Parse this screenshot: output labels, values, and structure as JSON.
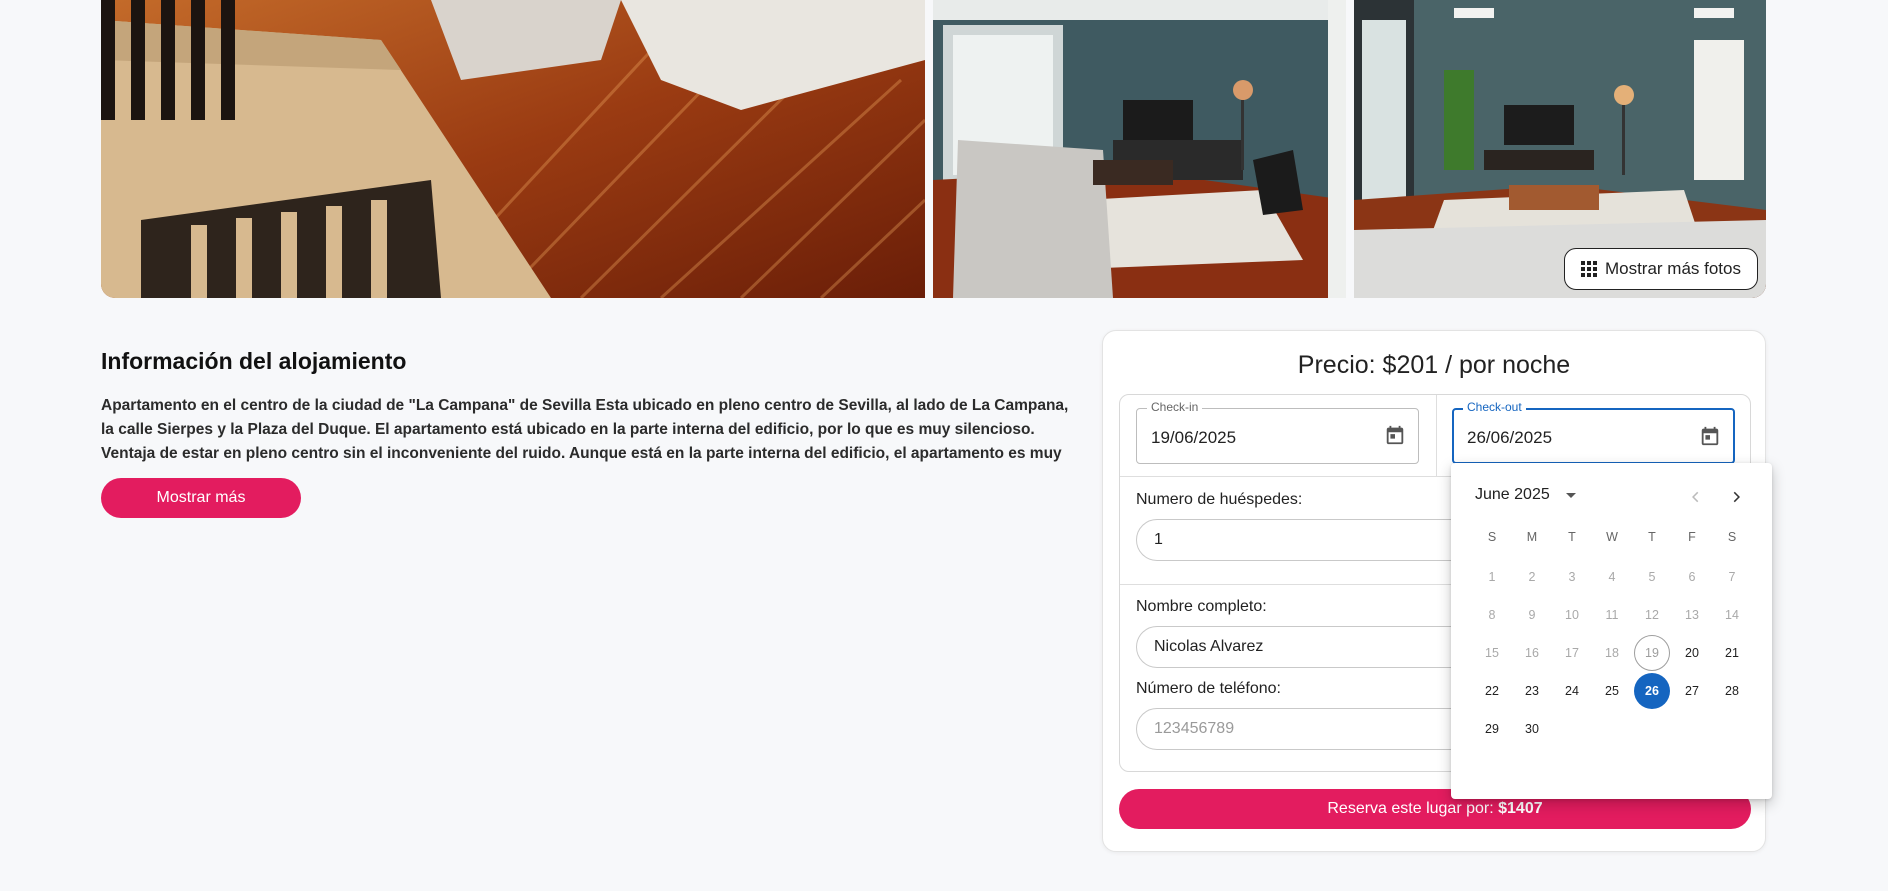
{
  "gallery": {
    "show_more_label": "Mostrar más fotos"
  },
  "info": {
    "title": "Información del alojamiento",
    "description": "Apartamento en el centro de la ciudad de \"La Campana\" de Sevilla Esta ubicado en pleno centro de Sevilla, al lado de La Campana, la calle Sierpes y la Plaza del Duque. El apartamento está ubicado en la parte interna del edificio, por lo que es muy silencioso. Ventaja de estar en pleno centro sin el inconveniente del ruido. Aunque está en la parte interna del edificio, el apartamento es muy luminos…",
    "show_more_label": "Mostrar más"
  },
  "booking": {
    "price_label": "Precio: $201 / por noche",
    "checkin": {
      "label": "Check-in",
      "value": "19/06/2025"
    },
    "checkout": {
      "label": "Check-out",
      "value": "26/06/2025"
    },
    "guests": {
      "label": "Numero de huéspedes:",
      "value": "1"
    },
    "name": {
      "label": "Nombre completo:",
      "value": "Nicolas Alvarez"
    },
    "phone": {
      "label": "Número de teléfono:",
      "placeholder": "123456789"
    },
    "reserve_label": "Reserva este lugar por:",
    "reserve_total": "$1407"
  },
  "datepicker": {
    "month_label": "June 2025",
    "weekdays": [
      "S",
      "M",
      "T",
      "W",
      "T",
      "F",
      "S"
    ],
    "range_start": 19,
    "selected": 26,
    "first_enabled": 20,
    "days": [
      "1",
      "2",
      "3",
      "4",
      "5",
      "6",
      "7",
      "8",
      "9",
      "10",
      "11",
      "12",
      "13",
      "14",
      "15",
      "16",
      "17",
      "18",
      "19",
      "20",
      "21",
      "22",
      "23",
      "24",
      "25",
      "26",
      "27",
      "28",
      "29",
      "30"
    ]
  },
  "colors": {
    "accent_pink": "#e31c5f",
    "picker_blue": "#1565c0"
  }
}
